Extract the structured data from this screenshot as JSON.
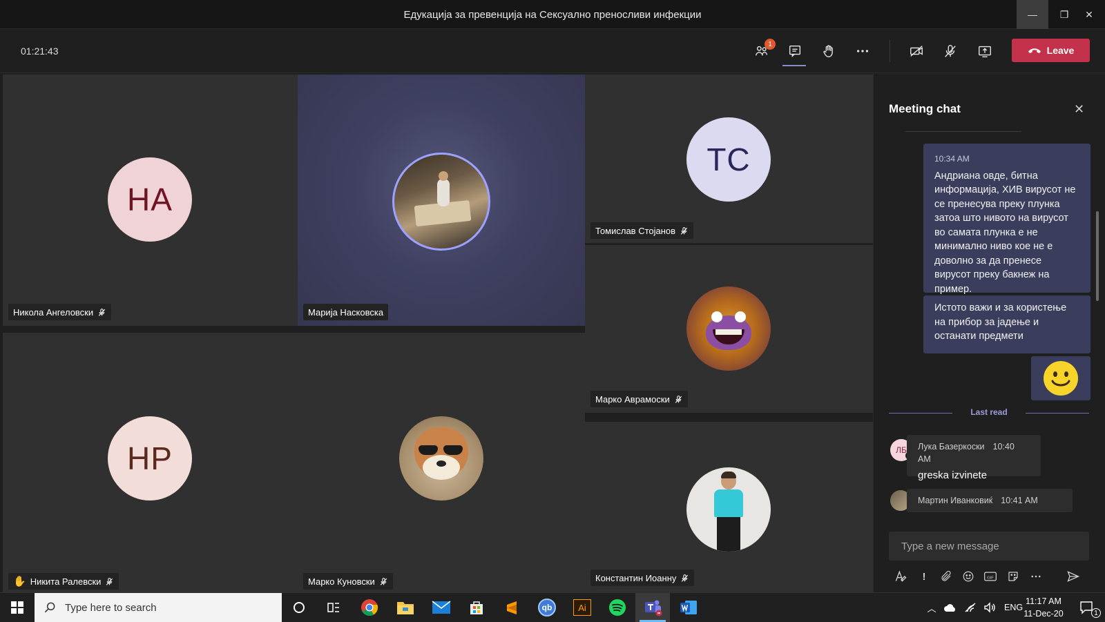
{
  "window": {
    "title": "Едукација за превенција на Сексуално преносливи инфекции",
    "minimize_glyph": "—",
    "maximize_glyph": "❐",
    "close_glyph": "✕"
  },
  "toolbar": {
    "timer": "01:21:43",
    "participants_badge": "1",
    "leave_label": "Leave"
  },
  "tiles": [
    {
      "name": "Никола Ангеловски",
      "initials": "НА",
      "avatar_bg": "#f0d3d6",
      "avatar_fg": "#6e1425",
      "muted": true,
      "hand_raised": false
    },
    {
      "name": "Марија Насковска",
      "initials": "",
      "muted": false,
      "hand_raised": false,
      "speaking": true,
      "avatar_icon": "photo-avatar-reading"
    },
    {
      "name": "Томислав Стојанов",
      "initials": "TC",
      "avatar_bg": "#dcdaf0",
      "avatar_fg": "#28265a",
      "muted": true,
      "hand_raised": false
    },
    {
      "name": "Марко Аврамоски",
      "initials": "",
      "muted": true,
      "hand_raised": false,
      "avatar_icon": "photo-avatar-crab"
    },
    {
      "name": "Никита Ралевски",
      "initials": "НР",
      "avatar_bg": "#f2ddd9",
      "avatar_fg": "#5a2a21",
      "muted": true,
      "hand_raised": true
    },
    {
      "name": "Марко Куновски",
      "initials": "",
      "muted": true,
      "hand_raised": false,
      "avatar_icon": "photo-avatar-dog"
    },
    {
      "name": "Константин Иоанну",
      "initials": "",
      "muted": true,
      "hand_raised": false,
      "avatar_icon": "photo-avatar-boy"
    }
  ],
  "chat": {
    "title": "Meeting chat",
    "messages_self": [
      {
        "time": "10:34 AM",
        "text": "Андриана овде, битна информација, ХИВ вирусот не се пренесува преку плунка затоа што нивото на вирусот во самата плунка е не минимално ниво кое не е доволно за да пренесе вирусот преку бакнеж на пример."
      },
      {
        "time": "",
        "text": "Истото важи и за користење на прибор за јадење и останати предмети"
      }
    ],
    "last_read_label": "Last read",
    "messages_other": [
      {
        "initials": "ЛБ",
        "author": "Лука Базеркоски",
        "time": "10:40 AM",
        "text": "greska izvinete"
      },
      {
        "initials": "",
        "author": "Мартин Иванковиќ",
        "time": "10:41 AM",
        "text": ""
      }
    ],
    "compose_placeholder": "Type a new message"
  },
  "taskbar": {
    "search_placeholder": "Type here to search",
    "apps": [
      "chrome-icon",
      "file-explorer-icon",
      "mail-icon",
      "store-icon",
      "sublime-icon",
      "qbittorrent-icon",
      "illustrator-icon",
      "spotify-icon",
      "teams-icon",
      "word-icon"
    ],
    "illustrator_label": "Ai",
    "qb_label": "qb",
    "language": "ENG",
    "time": "11:17 AM",
    "date": "11-Dec-20",
    "notification_count": "1"
  }
}
